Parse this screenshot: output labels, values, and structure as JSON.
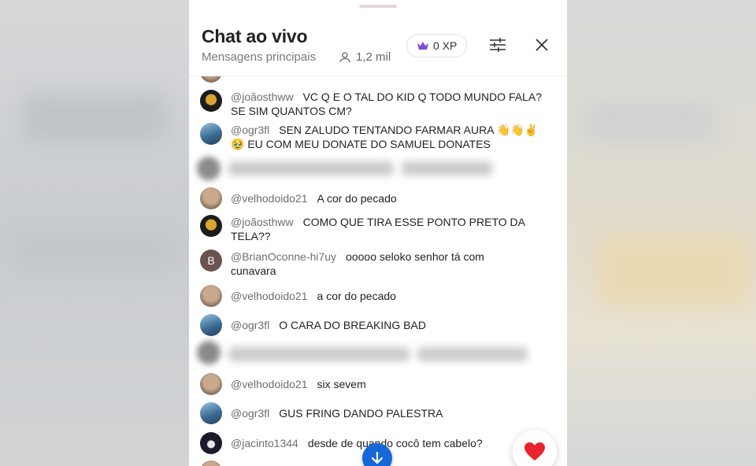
{
  "header": {
    "title": "Chat ao vivo",
    "subtitle": "Mensagens principais",
    "viewer_count": "1,2 mil",
    "xp_label": "0 XP"
  },
  "messages": [
    {
      "author": "@joãosthww",
      "line1": "VC Q E O TAL DO KID Q TODO MUNDO FALA?",
      "line2": "SE SIM QUANTOS CM?"
    },
    {
      "author": "@ogr3fl",
      "line1": "SEN ZALUDO TENTANDO FARMAR AURA 👋👋✌️",
      "line2": "🥹 EU COM MEU DONATE DO SAMUEL DONATES"
    },
    {
      "author": "@velhodoido21",
      "line1": "A cor do pecado"
    },
    {
      "author": "@joãosthww",
      "line1": "COMO QUE TIRA ESSE PONTO PRETO DA",
      "line2": "TELA??"
    },
    {
      "author": "@BrianOconne-hi7uy",
      "line1": "ooooo seloko senhor tá com",
      "line2": "cunavara",
      "avatar_letter": "B"
    },
    {
      "author": "@velhodoido21",
      "line1": "a cor do pecado"
    },
    {
      "author": "@ogr3fl",
      "line1": "O CARA DO BREAKING BAD"
    },
    {
      "author": "@velhodoido21",
      "line1": "six sevem"
    },
    {
      "author": "@ogr3fl",
      "line1": "GUS FRING DANDO PALESTRA"
    },
    {
      "author": "@jacinto1344",
      "line1": "desde de quando cocô tem cabelo?"
    }
  ],
  "colors": {
    "accent": "#1667d9",
    "crown": "#7b4fd6",
    "heart": "#e8242c"
  },
  "icons": [
    "crown-icon",
    "person-icon",
    "sliders-icon",
    "close-icon",
    "arrow-down-icon",
    "heart-icon"
  ]
}
